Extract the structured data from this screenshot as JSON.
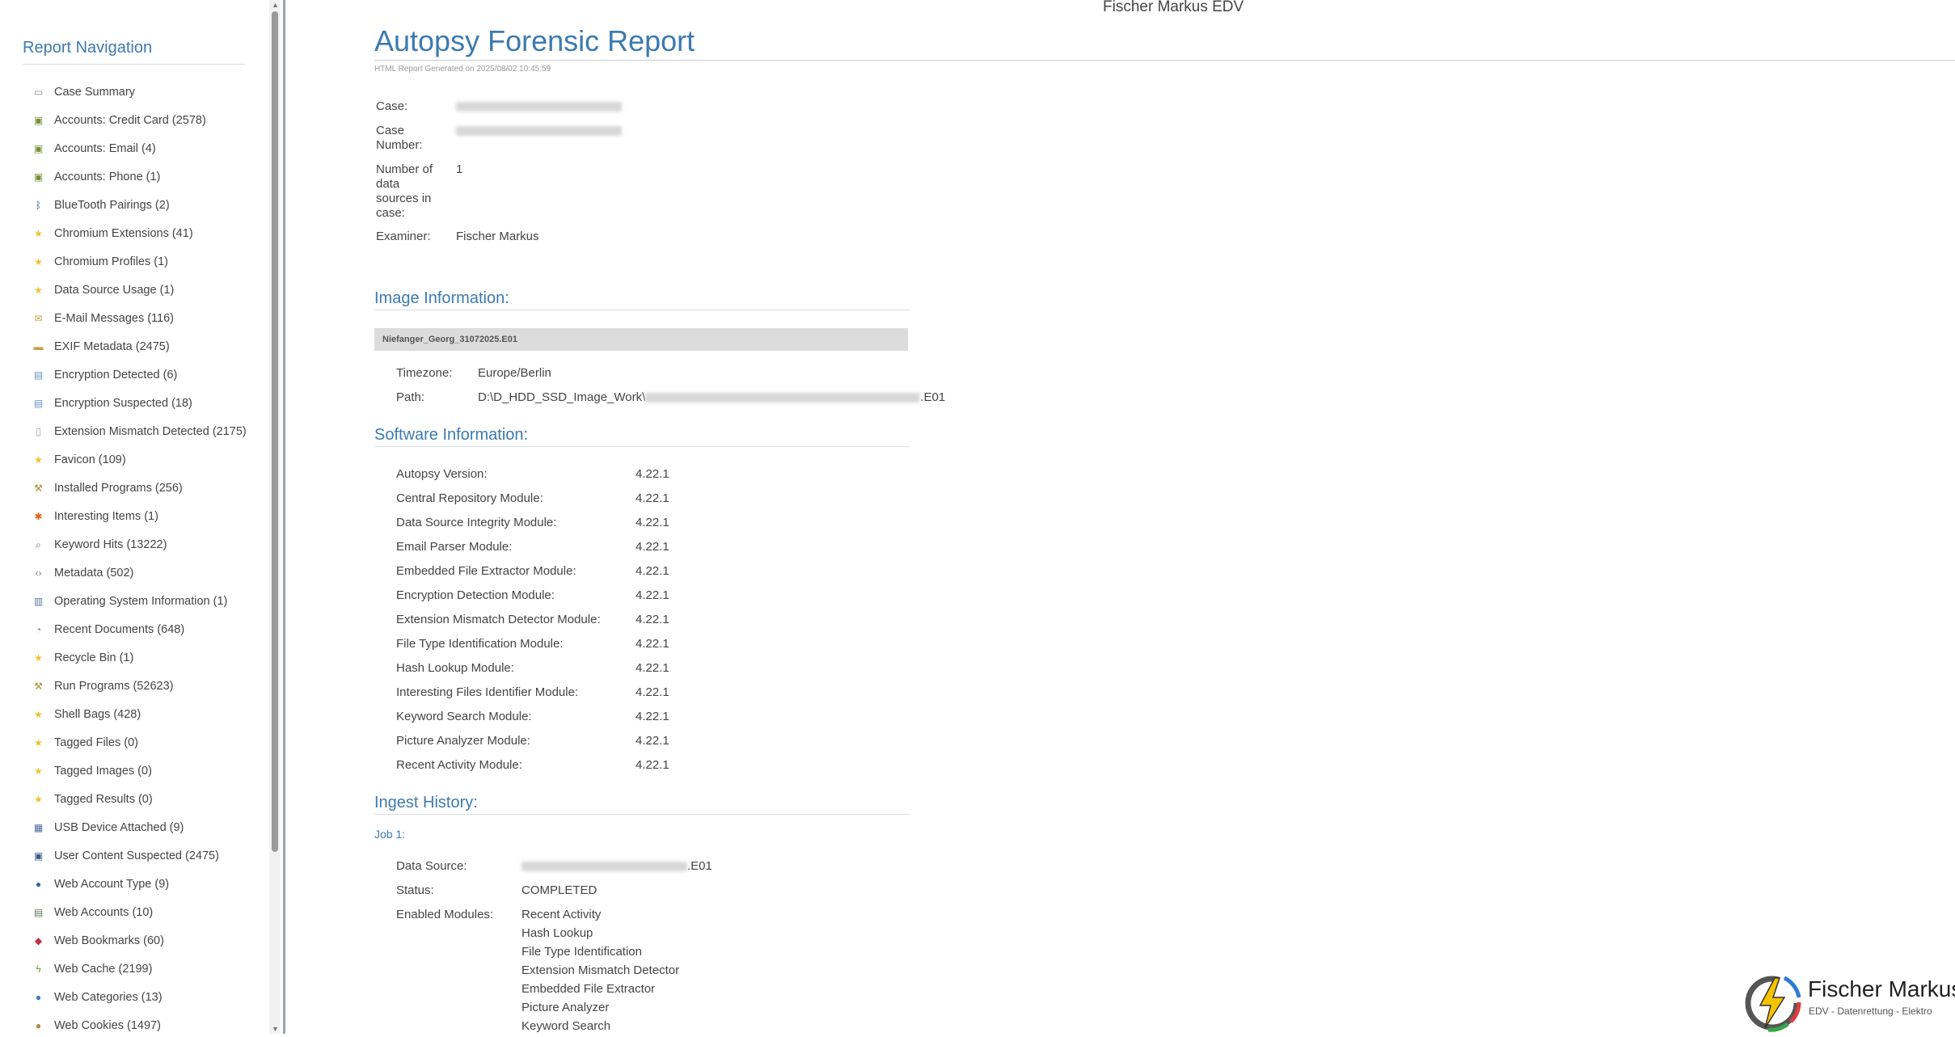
{
  "sidebar": {
    "heading": "Report Navigation",
    "items": [
      {
        "label": "Case Summary",
        "icon": "briefcase-icon",
        "color": "#8a8a8a"
      },
      {
        "label": "Accounts: Credit Card (2578)",
        "icon": "accounts-icon",
        "color": "#7a8f3a"
      },
      {
        "label": "Accounts: Email (4)",
        "icon": "accounts-icon",
        "color": "#7a8f3a"
      },
      {
        "label": "Accounts: Phone (1)",
        "icon": "accounts-icon",
        "color": "#7a8f3a"
      },
      {
        "label": "BlueTooth Pairings (2)",
        "icon": "bluetooth-icon",
        "color": "#2b4f8c"
      },
      {
        "label": "Chromium Extensions (41)",
        "icon": "star-icon",
        "color": "#f0c030"
      },
      {
        "label": "Chromium Profiles (1)",
        "icon": "star-icon",
        "color": "#f0c030"
      },
      {
        "label": "Data Source Usage (1)",
        "icon": "star-icon",
        "color": "#f0c030"
      },
      {
        "label": "E-Mail Messages (116)",
        "icon": "mail-icon",
        "color": "#c8a040"
      },
      {
        "label": "EXIF Metadata (2475)",
        "icon": "camera-icon",
        "color": "#c8a040"
      },
      {
        "label": "Encryption Detected (6)",
        "icon": "document-lock-icon",
        "color": "#6a8fc0"
      },
      {
        "label": "Encryption Suspected (18)",
        "icon": "document-lock-icon",
        "color": "#6a8fc0"
      },
      {
        "label": "Extension Mismatch Detected (2175)",
        "icon": "document-icon",
        "color": "#9aa0a8"
      },
      {
        "label": "Favicon (109)",
        "icon": "star-icon",
        "color": "#f0c030"
      },
      {
        "label": "Installed Programs (256)",
        "icon": "tools-icon",
        "color": "#b08a30"
      },
      {
        "label": "Interesting Items (1)",
        "icon": "asterisk-icon",
        "color": "#e06020"
      },
      {
        "label": "Keyword Hits (13222)",
        "icon": "magnifier-icon",
        "color": "#666666"
      },
      {
        "label": "Metadata (502)",
        "icon": "code-icon",
        "color": "#777777"
      },
      {
        "label": "Operating System Information (1)",
        "icon": "computer-icon",
        "color": "#5a7aa0"
      },
      {
        "label": "Recent Documents (648)",
        "icon": "clock-document-icon",
        "color": "#7a8a9a"
      },
      {
        "label": "Recycle Bin (1)",
        "icon": "star-icon",
        "color": "#f0c030"
      },
      {
        "label": "Run Programs (52623)",
        "icon": "tools-icon",
        "color": "#b08a30"
      },
      {
        "label": "Shell Bags (428)",
        "icon": "star-icon",
        "color": "#f0c030"
      },
      {
        "label": "Tagged Files (0)",
        "icon": "star-icon",
        "color": "#f0c030"
      },
      {
        "label": "Tagged Images (0)",
        "icon": "star-icon",
        "color": "#f0c030"
      },
      {
        "label": "Tagged Results (0)",
        "icon": "star-icon",
        "color": "#f0c030"
      },
      {
        "label": "USB Device Attached (9)",
        "icon": "usb-icon",
        "color": "#4a6a9a"
      },
      {
        "label": "User Content Suspected (2475)",
        "icon": "user-content-icon",
        "color": "#3a5a8a"
      },
      {
        "label": "Web Account Type (9)",
        "icon": "user-icon",
        "color": "#3a6aa8"
      },
      {
        "label": "Web Accounts (10)",
        "icon": "web-accounts-icon",
        "color": "#5a7a5a"
      },
      {
        "label": "Web Bookmarks (60)",
        "icon": "bookmark-icon",
        "color": "#c03040"
      },
      {
        "label": "Web Cache (2199)",
        "icon": "lightning-icon",
        "color": "#70a030"
      },
      {
        "label": "Web Categories (13)",
        "icon": "globe-icon",
        "color": "#3a7ac0"
      },
      {
        "label": "Web Cookies (1497)",
        "icon": "cookie-icon",
        "color": "#b08a50"
      }
    ]
  },
  "header": {
    "brand": "Fischer Markus EDV",
    "title": "Autopsy Forensic Report",
    "generated": "HTML Report Generated on 2025/08/02 10:45:59"
  },
  "case": {
    "case_label": "Case:",
    "case_number_label": "Case Number:",
    "data_sources_label": "Number of data sources in case:",
    "data_sources_value": "1",
    "examiner_label": "Examiner:",
    "examiner_value": "Fischer Markus"
  },
  "image_info": {
    "heading": "Image Information:",
    "image_name": "Niefanger_Georg_31072025.E01",
    "timezone_label": "Timezone:",
    "timezone_value": "Europe/Berlin",
    "path_label": "Path:",
    "path_prefix": "D:\\D_HDD_SSD_Image_Work\\",
    "path_suffix": ".E01"
  },
  "software_info": {
    "heading": "Software Information:",
    "rows": [
      {
        "label": "Autopsy Version:",
        "value": "4.22.1"
      },
      {
        "label": "Central Repository Module:",
        "value": "4.22.1"
      },
      {
        "label": "Data Source Integrity Module:",
        "value": "4.22.1"
      },
      {
        "label": "Email Parser Module:",
        "value": "4.22.1"
      },
      {
        "label": "Embedded File Extractor Module:",
        "value": "4.22.1"
      },
      {
        "label": "Encryption Detection Module:",
        "value": "4.22.1"
      },
      {
        "label": "Extension Mismatch Detector Module:",
        "value": "4.22.1"
      },
      {
        "label": "File Type Identification Module:",
        "value": "4.22.1"
      },
      {
        "label": "Hash Lookup Module:",
        "value": "4.22.1"
      },
      {
        "label": "Interesting Files Identifier Module:",
        "value": "4.22.1"
      },
      {
        "label": "Keyword Search Module:",
        "value": "4.22.1"
      },
      {
        "label": "Picture Analyzer Module:",
        "value": "4.22.1"
      },
      {
        "label": "Recent Activity Module:",
        "value": "4.22.1"
      }
    ]
  },
  "ingest_history": {
    "heading": "Ingest History:",
    "job_label": "Job 1:",
    "data_source_label": "Data Source:",
    "data_source_suffix": ".E01",
    "status_label": "Status:",
    "status_value": "COMPLETED",
    "enabled_label": "Enabled Modules:",
    "modules": [
      "Recent Activity",
      "Hash Lookup",
      "File Type Identification",
      "Extension Mismatch Detector",
      "Embedded File Extractor",
      "Picture Analyzer",
      "Keyword Search"
    ]
  },
  "logo": {
    "name": "Fischer Markus",
    "tagline": "EDV - Datenrettung - Elektro"
  }
}
